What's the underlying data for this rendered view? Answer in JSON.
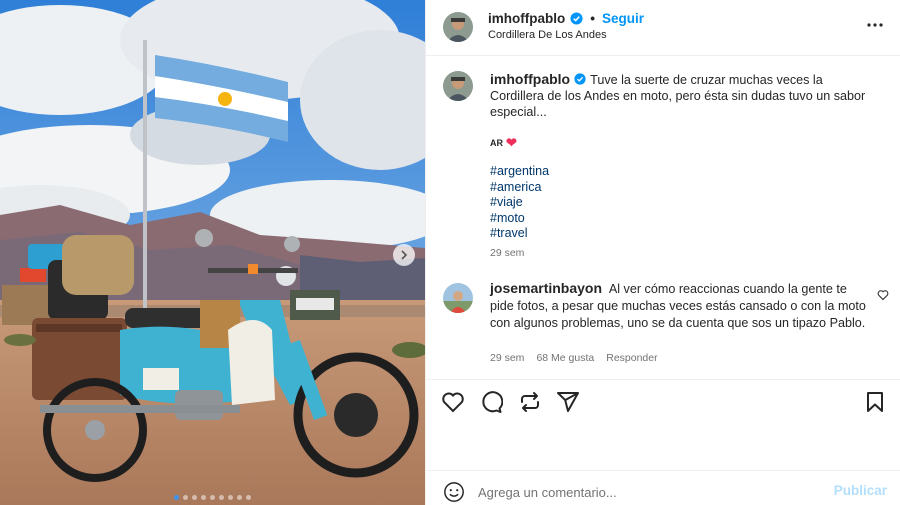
{
  "post": {
    "author": "imhoffpablo",
    "follow_label": "Seguir",
    "separator": "•",
    "location": "Cordillera De Los Andes",
    "more_icon": "more-horizontal-icon",
    "verified_icon": "verified-badge-icon"
  },
  "caption": {
    "username": "imhoffpablo",
    "text": "Tuve la suerte de cruzar muchas veces la Cordillera de los Andes en moto, pero ésta sin dudas tuvo un sabor especial...",
    "flag_text": "AR",
    "heart": "❤",
    "hashtags": [
      "#argentina",
      "#america",
      "#viaje",
      "#moto",
      "#travel"
    ],
    "time": "29 sem"
  },
  "comment": {
    "username": "josemartinbayon",
    "text": "Al ver cómo reaccionas cuando la gente te pide fotos, a pesar que muchas veces estás cansado o con la moto con algunos problemas, uno se da cuenta que sos un tipazo Pablo.",
    "time": "29 sem",
    "likes": "68 Me gusta",
    "reply_label": "Responder"
  },
  "actions": [
    "heart-icon",
    "comment-icon",
    "repost-icon",
    "share-icon",
    "bookmark-icon"
  ],
  "add_comment": {
    "placeholder": "Agrega un comentario...",
    "publish_label": "Publicar"
  },
  "carousel": {
    "dot_count": 9,
    "active_index": 0
  },
  "colors": {
    "accent": "#0095f6",
    "link": "#00376b",
    "publish_disabled": "#b2dffc",
    "secondary_text": "#737373"
  }
}
